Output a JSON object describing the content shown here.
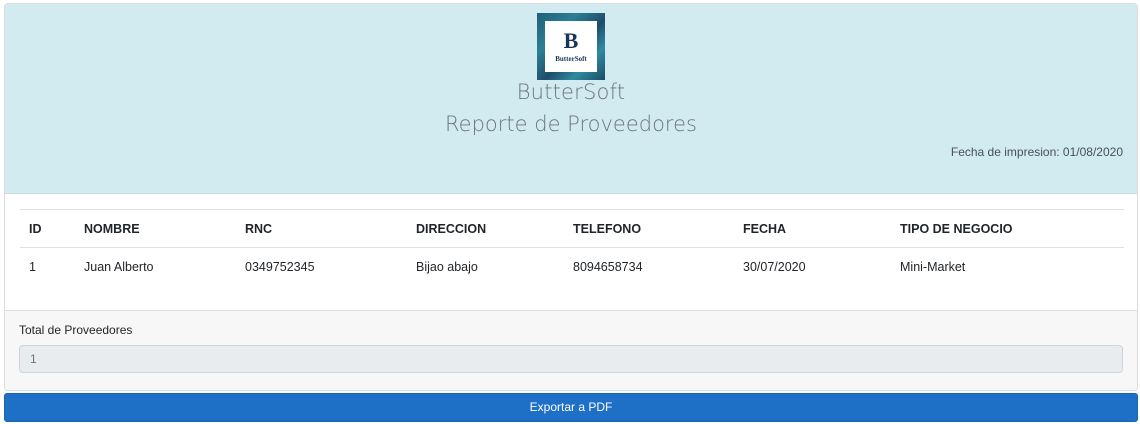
{
  "header": {
    "logo": {
      "letter": "B",
      "text": "ButterSoft",
      "colors": [
        "#1f5f7a",
        "#2c7f93",
        "#1d4e6b"
      ]
    },
    "brand": "ButterSoft",
    "title": "Reporte de Proveedores",
    "print_date": "Fecha de impresion: 01/08/2020"
  },
  "table": {
    "columns": [
      "ID",
      "NOMBRE",
      "RNC",
      "DIRECCION",
      "TELEFONO",
      "FECHA",
      "TIPO DE NEGOCIO"
    ],
    "rows": [
      [
        "1",
        "Juan Alberto",
        "0349752345",
        "Bijao abajo",
        "8094658734",
        "30/07/2020",
        "Mini-Market"
      ]
    ]
  },
  "footer": {
    "total_label": "Total de Proveedores",
    "total_value": "1"
  },
  "actions": {
    "export_label": "Exportar a PDF"
  },
  "colors": {
    "header_bg": "#d1ebf0",
    "button_bg": "#1e6fc6"
  }
}
